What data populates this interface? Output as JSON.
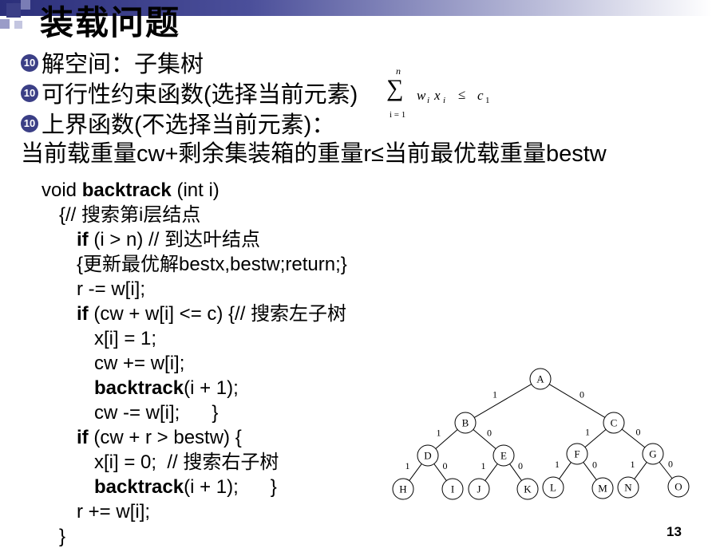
{
  "title": "装载问题",
  "bullets": {
    "b1": "解空间：子集树",
    "b2": "可行性约束函数(选择当前元素)",
    "b3": "上界函数(不选择当前元素)："
  },
  "bound_line": "当前载重量cw+剩余集装箱的重量r≤当前最优载重量bestw",
  "formula": {
    "sum": "∑",
    "upper": "n",
    "lower": "i = 1",
    "w": "w",
    "wi": "i",
    "x": "x",
    "xi": "i",
    "le": "≤",
    "c": "c",
    "c1": "1"
  },
  "code": {
    "l1": {
      "pre": "void ",
      "kw": "backtrack",
      "post": " (int i)"
    },
    "l2": "{// 搜索第i层结点",
    "l3": {
      "kw": "if",
      "post": " (i > n)  // 到达叶结点"
    },
    "l4": "{更新最优解bestx,bestw;return;}",
    "l5": "r -= w[i];",
    "l6": {
      "kw": "if",
      "post": " (cw + w[i] <= c) {// 搜索左子树"
    },
    "l7": "x[i] = 1;",
    "l8": "cw += w[i];",
    "l9": {
      "kw": "backtrack",
      "post": "(i + 1);"
    },
    "l10": "cw -= w[i];      }",
    "l11": {
      "kw": "if",
      "post": " (cw + r > bestw)  {"
    },
    "l12": "x[i] = 0;  // 搜索右子树",
    "l13": {
      "kw": "backtrack",
      "post": "(i + 1);      }"
    },
    "l14": "r += w[i];",
    "l15": "}"
  },
  "page_number": "13",
  "tree": {
    "nodes": [
      "A",
      "B",
      "C",
      "D",
      "E",
      "F",
      "G",
      "H",
      "I",
      "J",
      "K",
      "L",
      "M",
      "N",
      "O"
    ],
    "edge_labels": {
      "left": "1",
      "right": "0"
    }
  },
  "colors": {
    "bullet": "#3b3f86",
    "topbar": "#2b2f7a"
  },
  "icons": {
    "bullet": "numbered-circle-icon"
  }
}
